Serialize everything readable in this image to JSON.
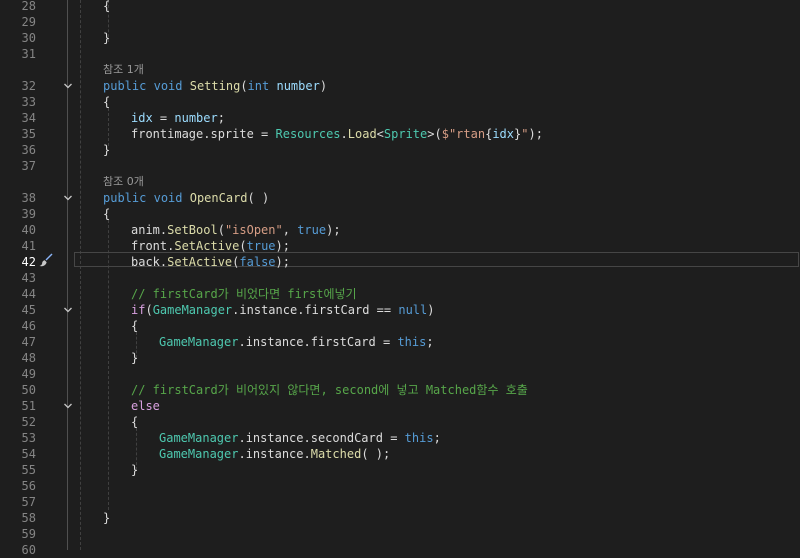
{
  "editor": {
    "active_line": 42,
    "lines": [
      {
        "n": 28,
        "fold": "",
        "indent": 4,
        "tokens": [
          {
            "t": "{",
            "c": "txt"
          }
        ]
      },
      {
        "n": 29,
        "fold": "",
        "indent": 4,
        "tokens": []
      },
      {
        "n": 30,
        "fold": "",
        "indent": 4,
        "tokens": [
          {
            "t": "}",
            "c": "txt"
          }
        ]
      },
      {
        "n": 31,
        "fold": "",
        "indent": 0,
        "tokens": []
      },
      {
        "lens": "참조 1개"
      },
      {
        "n": 32,
        "fold": "v",
        "indent": 4,
        "tokens": [
          {
            "t": "public",
            "c": "kw"
          },
          {
            "t": " ",
            "c": "txt"
          },
          {
            "t": "void",
            "c": "kw"
          },
          {
            "t": " ",
            "c": "txt"
          },
          {
            "t": "Setting",
            "c": "fn"
          },
          {
            "t": "(",
            "c": "txt"
          },
          {
            "t": "int",
            "c": "kw"
          },
          {
            "t": " ",
            "c": "txt"
          },
          {
            "t": "number",
            "c": "var"
          },
          {
            "t": ")",
            "c": "txt"
          }
        ]
      },
      {
        "n": 33,
        "fold": "",
        "indent": 4,
        "tokens": [
          {
            "t": "{",
            "c": "txt"
          }
        ]
      },
      {
        "n": 34,
        "fold": "",
        "indent": 8,
        "tokens": [
          {
            "t": "idx",
            "c": "var"
          },
          {
            "t": " = ",
            "c": "txt"
          },
          {
            "t": "number",
            "c": "var"
          },
          {
            "t": ";",
            "c": "txt"
          }
        ]
      },
      {
        "n": 35,
        "fold": "",
        "indent": 8,
        "tokens": [
          {
            "t": "frontimage.sprite = ",
            "c": "txt"
          },
          {
            "t": "Resources",
            "c": "ty"
          },
          {
            "t": ".",
            "c": "txt"
          },
          {
            "t": "Load",
            "c": "fn"
          },
          {
            "t": "<",
            "c": "txt"
          },
          {
            "t": "Sprite",
            "c": "ty"
          },
          {
            "t": ">(",
            "c": "txt"
          },
          {
            "t": "$\"rtan",
            "c": "str"
          },
          {
            "t": "{",
            "c": "txt"
          },
          {
            "t": "idx",
            "c": "var"
          },
          {
            "t": "}",
            "c": "txt"
          },
          {
            "t": "\"",
            "c": "str"
          },
          {
            "t": ");",
            "c": "txt"
          }
        ]
      },
      {
        "n": 36,
        "fold": "",
        "indent": 4,
        "tokens": [
          {
            "t": "}",
            "c": "txt"
          }
        ]
      },
      {
        "n": 37,
        "fold": "",
        "indent": 0,
        "tokens": []
      },
      {
        "lens": "참조 0개"
      },
      {
        "n": 38,
        "fold": "v",
        "indent": 4,
        "tokens": [
          {
            "t": "public",
            "c": "kw"
          },
          {
            "t": " ",
            "c": "txt"
          },
          {
            "t": "void",
            "c": "kw"
          },
          {
            "t": " ",
            "c": "txt"
          },
          {
            "t": "OpenCard",
            "c": "fn"
          },
          {
            "t": "( )",
            "c": "txt"
          }
        ]
      },
      {
        "n": 39,
        "fold": "",
        "indent": 4,
        "tokens": [
          {
            "t": "{",
            "c": "txt"
          }
        ]
      },
      {
        "n": 40,
        "fold": "",
        "indent": 8,
        "tokens": [
          {
            "t": "anim.",
            "c": "txt"
          },
          {
            "t": "SetBool",
            "c": "fn"
          },
          {
            "t": "(",
            "c": "txt"
          },
          {
            "t": "\"isOpen\"",
            "c": "str"
          },
          {
            "t": ", ",
            "c": "txt"
          },
          {
            "t": "true",
            "c": "kw"
          },
          {
            "t": ");",
            "c": "txt"
          }
        ]
      },
      {
        "n": 41,
        "fold": "",
        "indent": 8,
        "tokens": [
          {
            "t": "front.",
            "c": "txt"
          },
          {
            "t": "SetActive",
            "c": "fn"
          },
          {
            "t": "(",
            "c": "txt"
          },
          {
            "t": "true",
            "c": "kw"
          },
          {
            "t": ");",
            "c": "txt"
          }
        ]
      },
      {
        "n": 42,
        "fold": "",
        "indent": 8,
        "tokens": [
          {
            "t": "back.",
            "c": "txt"
          },
          {
            "t": "SetActive",
            "c": "fn"
          },
          {
            "t": "(",
            "c": "txt"
          },
          {
            "t": "false",
            "c": "kw"
          },
          {
            "t": ");",
            "c": "txt"
          }
        ]
      },
      {
        "n": 43,
        "fold": "",
        "indent": 8,
        "tokens": []
      },
      {
        "n": 44,
        "fold": "",
        "indent": 8,
        "tokens": [
          {
            "t": "// firstCard가 비었다면 first에넣기",
            "c": "cm"
          }
        ]
      },
      {
        "n": 45,
        "fold": "v",
        "indent": 8,
        "tokens": [
          {
            "t": "if",
            "c": "ctl"
          },
          {
            "t": "(",
            "c": "txt"
          },
          {
            "t": "GameManager",
            "c": "ty"
          },
          {
            "t": ".instance.firstCard == ",
            "c": "txt"
          },
          {
            "t": "null",
            "c": "kw"
          },
          {
            "t": ")",
            "c": "txt"
          }
        ]
      },
      {
        "n": 46,
        "fold": "",
        "indent": 8,
        "tokens": [
          {
            "t": "{",
            "c": "txt"
          }
        ]
      },
      {
        "n": 47,
        "fold": "",
        "indent": 12,
        "tokens": [
          {
            "t": "GameManager",
            "c": "ty"
          },
          {
            "t": ".instance.firstCard = ",
            "c": "txt"
          },
          {
            "t": "this",
            "c": "kw"
          },
          {
            "t": ";",
            "c": "txt"
          }
        ]
      },
      {
        "n": 48,
        "fold": "",
        "indent": 8,
        "tokens": [
          {
            "t": "}",
            "c": "txt"
          }
        ]
      },
      {
        "n": 49,
        "fold": "",
        "indent": 8,
        "tokens": []
      },
      {
        "n": 50,
        "fold": "",
        "indent": 8,
        "tokens": [
          {
            "t": "// firstCard가 비어있지 않다면, second에 넣고 Matched함수 호출",
            "c": "cm"
          }
        ]
      },
      {
        "n": 51,
        "fold": "v",
        "indent": 8,
        "tokens": [
          {
            "t": "else",
            "c": "ctl"
          }
        ]
      },
      {
        "n": 52,
        "fold": "",
        "indent": 8,
        "tokens": [
          {
            "t": "{",
            "c": "txt"
          }
        ]
      },
      {
        "n": 53,
        "fold": "",
        "indent": 12,
        "tokens": [
          {
            "t": "GameManager",
            "c": "ty"
          },
          {
            "t": ".instance.secondCard = ",
            "c": "txt"
          },
          {
            "t": "this",
            "c": "kw"
          },
          {
            "t": ";",
            "c": "txt"
          }
        ]
      },
      {
        "n": 54,
        "fold": "",
        "indent": 12,
        "tokens": [
          {
            "t": "GameManager",
            "c": "ty"
          },
          {
            "t": ".instance.",
            "c": "txt"
          },
          {
            "t": "Matched",
            "c": "fn"
          },
          {
            "t": "( );",
            "c": "txt"
          }
        ]
      },
      {
        "n": 55,
        "fold": "",
        "indent": 8,
        "tokens": [
          {
            "t": "}",
            "c": "txt"
          }
        ]
      },
      {
        "n": 56,
        "fold": "",
        "indent": 8,
        "tokens": []
      },
      {
        "n": 57,
        "fold": "",
        "indent": 8,
        "tokens": []
      },
      {
        "n": 58,
        "fold": "",
        "indent": 4,
        "tokens": [
          {
            "t": "}",
            "c": "txt"
          }
        ]
      },
      {
        "n": 59,
        "fold": "",
        "indent": 0,
        "tokens": []
      },
      {
        "n": 60,
        "fold": "",
        "indent": 0,
        "tokens": []
      }
    ]
  },
  "icons": {
    "fold": "chevron-down-icon",
    "quick_action": "paintbrush-icon"
  },
  "colors": {
    "background": "#1e1e1e",
    "keyword": "#569cd6",
    "control": "#d8a0df",
    "type": "#4ec9b0",
    "method": "#dcdcaa",
    "string": "#d69d85",
    "comment": "#57a64a",
    "variable": "#9cdcfe"
  }
}
